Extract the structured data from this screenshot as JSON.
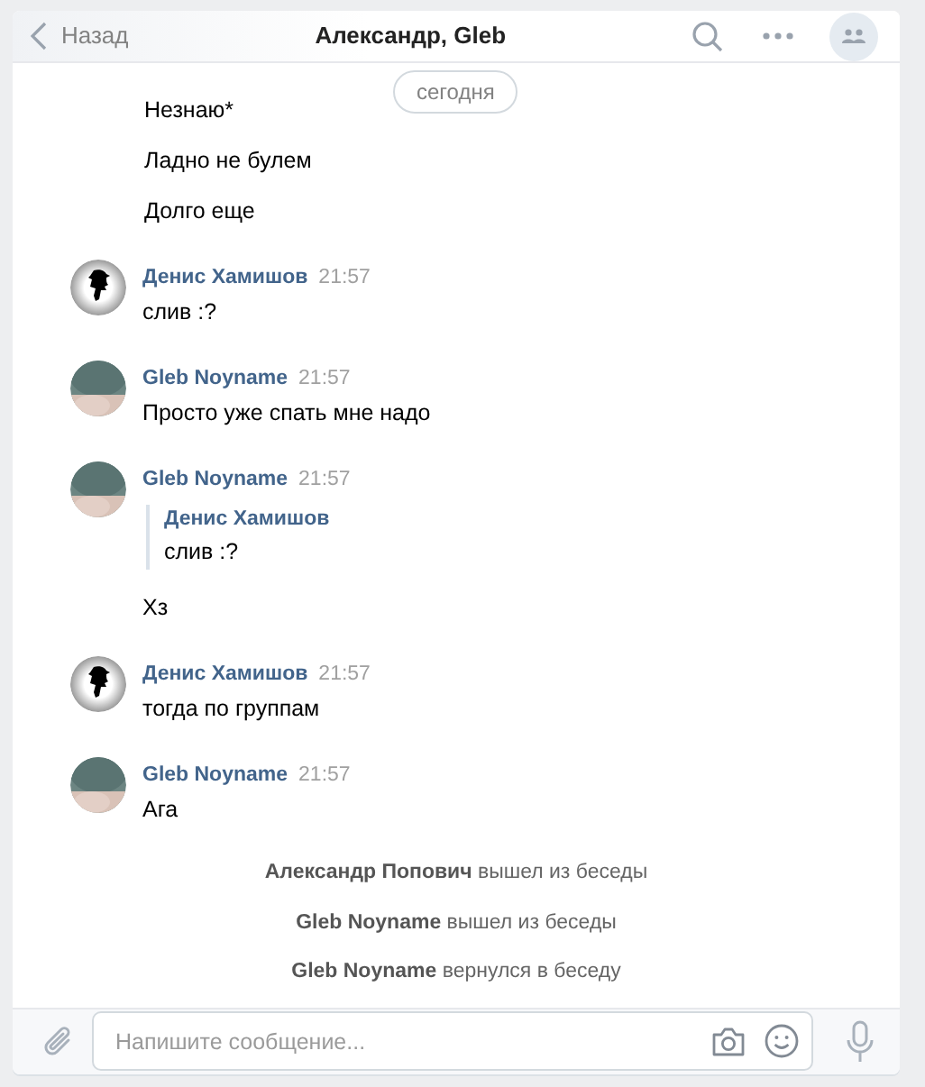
{
  "header": {
    "back": "Назад",
    "title": "Александр, Gleb"
  },
  "date_pill": "сегодня",
  "messages": [
    {
      "kind": "text",
      "text": "Незнаю*"
    },
    {
      "kind": "text",
      "text": "Ладно не булем"
    },
    {
      "kind": "text",
      "text": "Долго еще"
    },
    {
      "kind": "message",
      "photo_avatar": false,
      "author": "Денис Хамишов",
      "time": "21:57",
      "text": "слив :?"
    },
    {
      "kind": "message",
      "photo_avatar": true,
      "author": "Gleb Noyname",
      "time": "21:57",
      "text": "Просто уже спать мне надо"
    },
    {
      "kind": "message",
      "photo_avatar": true,
      "author": "Gleb Noyname",
      "time": "21:57",
      "quote": {
        "author": "Денис Хамишов",
        "text": "слив :?"
      },
      "text": "Хз"
    },
    {
      "kind": "message",
      "photo_avatar": false,
      "author": "Денис Хамишов",
      "time": "21:57",
      "text": "тогда по группам"
    },
    {
      "kind": "message",
      "photo_avatar": true,
      "author": "Gleb Noyname",
      "time": "21:57",
      "text": "Ага"
    },
    {
      "kind": "system",
      "text": "**Александр Попович** вышел из беседы"
    },
    {
      "kind": "system",
      "text": "**Gleb Noyname** вышел из беседы"
    },
    {
      "kind": "system",
      "text": "**Gleb Noyname** вернулся в беседу"
    }
  ],
  "composer": {
    "placeholder": "Напишите сообщение..."
  }
}
